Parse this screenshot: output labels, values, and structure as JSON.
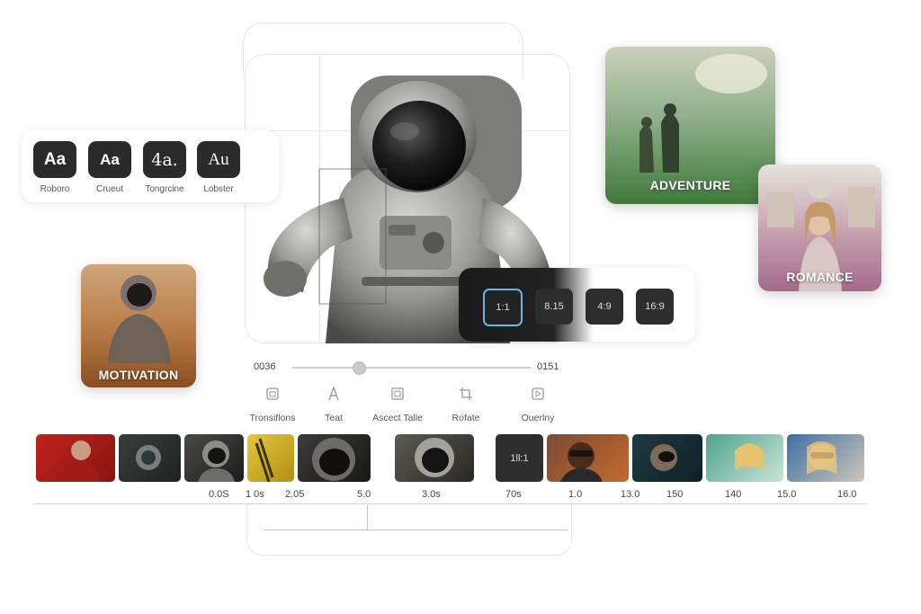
{
  "fonts": [
    {
      "glyph": "Aa",
      "name": "Roboro"
    },
    {
      "glyph": "Aa",
      "name": "Crueut"
    },
    {
      "glyph": "4a.",
      "name": "Tongrcine"
    },
    {
      "glyph": "Au",
      "name": "Lobster"
    }
  ],
  "themes": {
    "adventure": "ADVENTURE",
    "romance": "ROMANCE",
    "motivation": "MOTIVATION"
  },
  "aspect_ratios": [
    {
      "label": "1:1",
      "selected": true
    },
    {
      "label": "8.15",
      "selected": false
    },
    {
      "label": "4:9",
      "selected": false
    },
    {
      "label": "16:9",
      "selected": false
    }
  ],
  "slider": {
    "start": "0036",
    "end": "0151",
    "position": 0.28
  },
  "tools": [
    {
      "label": "Tronsiflons",
      "icon": "transitions-icon"
    },
    {
      "label": "Teat",
      "icon": "text-icon"
    },
    {
      "label": "Ascect Talle",
      "icon": "aspect-ratio-icon"
    },
    {
      "label": "Rofate",
      "icon": "crop-rotate-icon"
    },
    {
      "label": "Ouerlny",
      "icon": "overlay-icon"
    }
  ],
  "timeline": {
    "ratio_clip_label": "1ll:1",
    "ticks": [
      "0.0S",
      "1 0s",
      "2.05",
      "5.0",
      "3.0s",
      "70s",
      "1.0",
      "13.0",
      "150",
      "140",
      "15.0",
      "16.0"
    ]
  },
  "colors": {
    "accent": "#6fb4e6",
    "tile": "#2b2b2b"
  }
}
